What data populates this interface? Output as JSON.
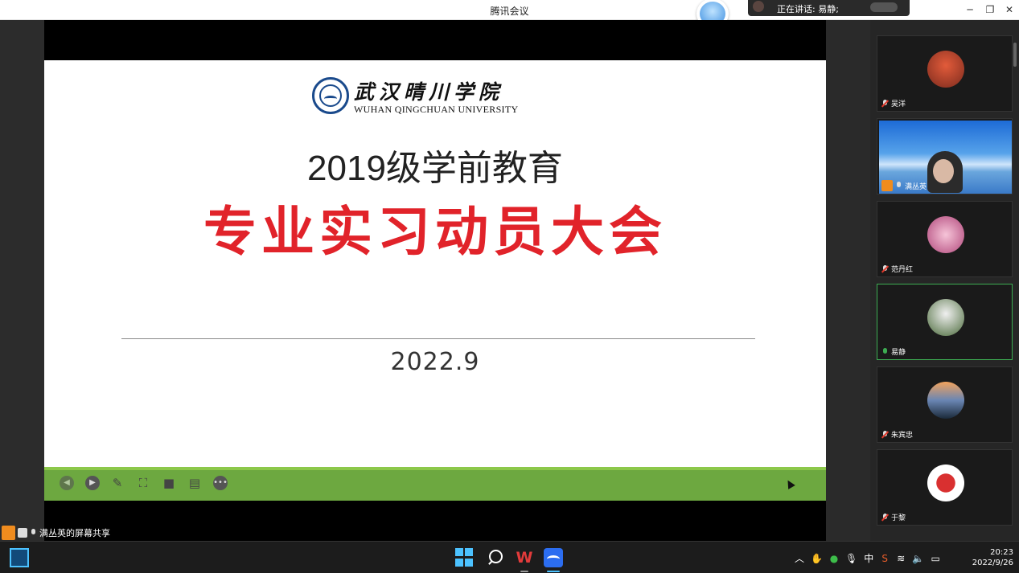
{
  "window": {
    "title": "腾讯会议",
    "speaking_label": "正在讲话: 易静;"
  },
  "slide": {
    "university_cn": "武汉晴川学院",
    "university_en": "WUHAN QINGCHUAN UNIVERSITY",
    "line1": "2019级学前教育",
    "line2": "专业实习动员大会",
    "date": "2022.9"
  },
  "participants": [
    {
      "name": "吴洋",
      "mic": "muted"
    },
    {
      "name": "满丛英",
      "mic": "on"
    },
    {
      "name": "范丹红",
      "mic": "muted"
    },
    {
      "name": "易静",
      "mic": "live"
    },
    {
      "name": "朱宾忠",
      "mic": "muted"
    },
    {
      "name": "于黎",
      "mic": "muted"
    }
  ],
  "share_bar": {
    "label": "满丛英的屏幕共享"
  },
  "taskbar": {
    "ime": "中",
    "time": "20:23",
    "date": "2022/9/26"
  },
  "icons": [
    "minimize-icon",
    "restore-icon",
    "close-icon",
    "start-icon",
    "search-icon",
    "wps-icon",
    "tencent-meeting-icon"
  ]
}
